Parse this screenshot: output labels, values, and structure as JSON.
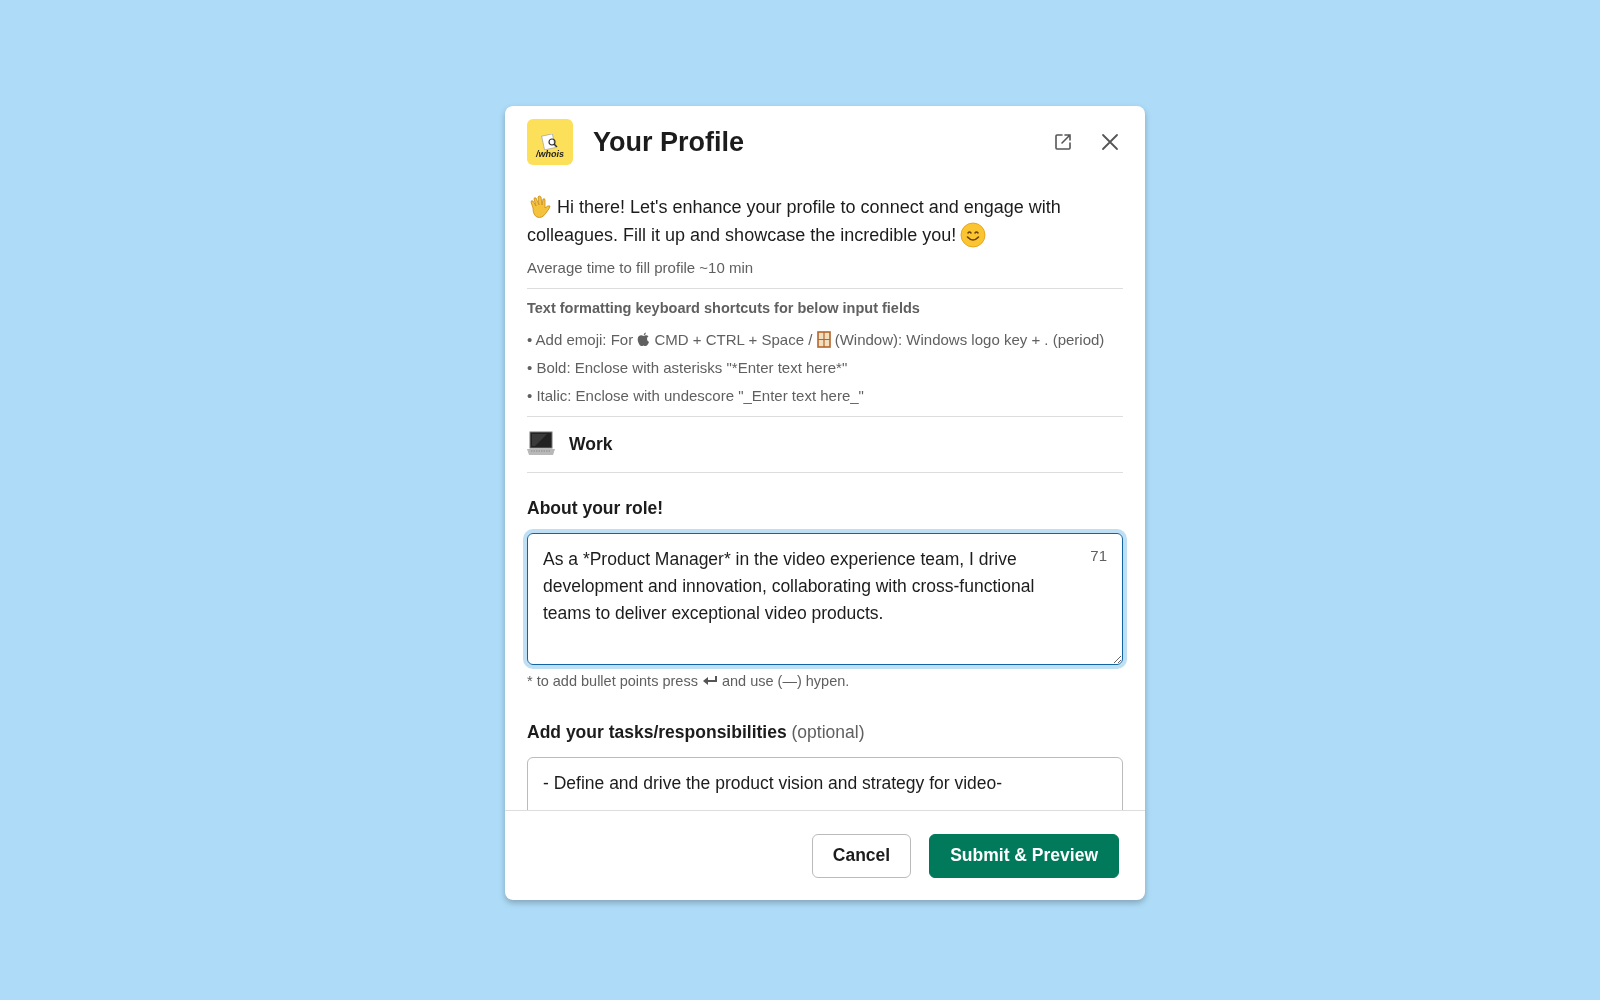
{
  "dialog": {
    "logo_text": "/whois",
    "title": "Your Profile"
  },
  "intro": {
    "lines": [
      "Hi there! Let's enhance your profile to connect and engage with",
      "colleagues. Fill it up and showcase the incredible you!"
    ],
    "note": "Average time to fill profile ~10 min"
  },
  "shortcuts": {
    "heading": "Text formatting keyboard shortcuts for below input fields",
    "items": [
      {
        "kind": "emoji",
        "before": "• Add emoji: For",
        "middle": "CMD + CTRL + Space /",
        "after": "(Window): Windows logo key + . (period)"
      },
      {
        "kind": "text",
        "text": "• Bold: Enclose with asterisks \"*Enter text here*\""
      },
      {
        "kind": "text",
        "text": "• Italic: Enclose with undescore \"_Enter text here_\""
      }
    ]
  },
  "section": {
    "title": "Work"
  },
  "role_field": {
    "label": "About your role!",
    "value": "As a *Product Manager* in the video experience team, I drive development and innovation, collaborating with cross-functional teams to deliver exceptional video products.",
    "counter": "71",
    "focused": true,
    "hint_before": "* to add bullet points press",
    "hint_after": "and use (—) hypen."
  },
  "tasks_field": {
    "label": "Add your tasks/responsibilities",
    "label_note": "(optional)",
    "value": "- Define and drive the product vision and strategy for video-",
    "focused": false
  },
  "buttons": [
    {
      "label": "Cancel",
      "kind": "secondary"
    },
    {
      "label": "Submit & Preview",
      "kind": "primary"
    }
  ]
}
